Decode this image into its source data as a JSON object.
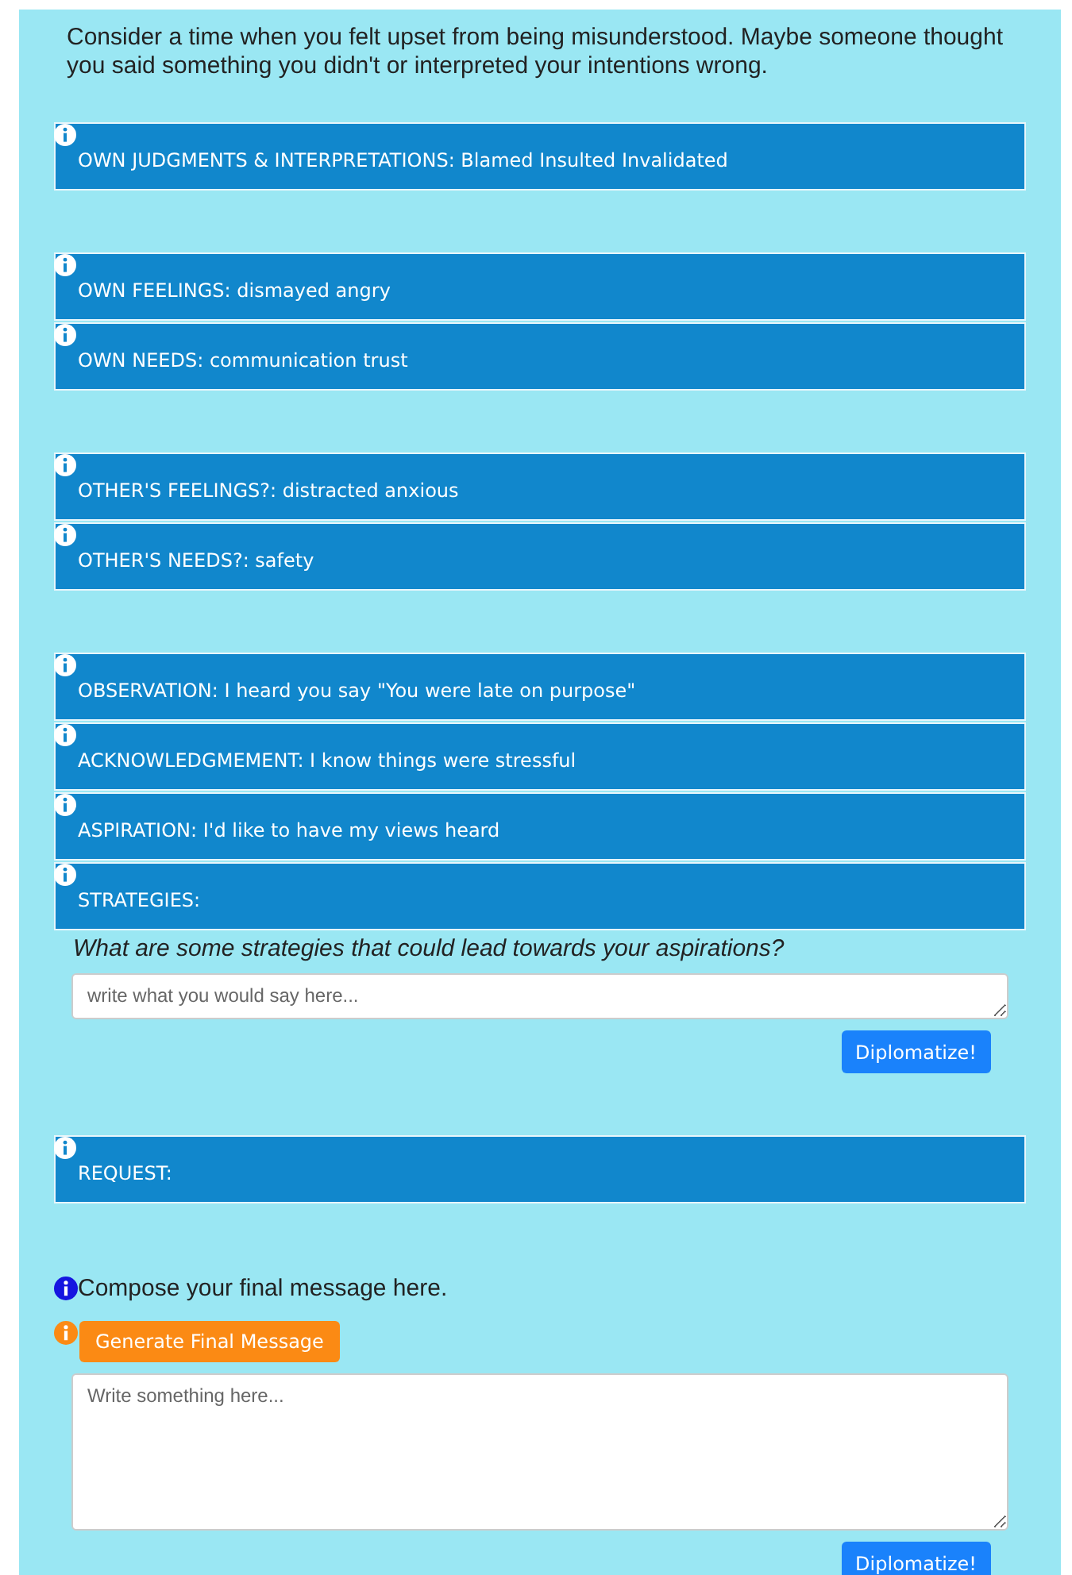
{
  "intro": "Consider a time when you felt upset from being misunderstood. Maybe someone thought you said something you didn't or interpreted your intentions wrong.",
  "sections": [
    {
      "kind": "bars",
      "bars": [
        {
          "text": "OWN JUDGMENTS & INTERPRETATIONS: Blamed Insulted Invalidated"
        }
      ]
    },
    {
      "kind": "bars",
      "bars": [
        {
          "text": "OWN FEELINGS: dismayed angry"
        },
        {
          "text": "OWN NEEDS: communication trust"
        }
      ]
    },
    {
      "kind": "bars",
      "bars": [
        {
          "text": "OTHER'S FEELINGS?: distracted anxious"
        },
        {
          "text": "OTHER'S NEEDS?: safety"
        }
      ]
    },
    {
      "kind": "prompt",
      "bars": [
        {
          "text": "OBSERVATION: I heard you say \"You were late on purpose\""
        },
        {
          "text": "ACKNOWLEDGMEMENT: I know things were stressful"
        },
        {
          "text": "ASPIRATION: I'd like to have my views heard"
        },
        {
          "text": "STRATEGIES:"
        }
      ],
      "question": "What are some strategies that could lead towards your aspirations?",
      "placeholder": "write what you would say here...",
      "button": "Diplomatize!"
    },
    {
      "kind": "bars",
      "bars": [
        {
          "text": "REQUEST:"
        }
      ]
    }
  ],
  "final": {
    "heading": "Compose your final message here.",
    "generate_button": "Generate Final Message",
    "placeholder": "Write something here...",
    "button": "Diplomatize!"
  }
}
